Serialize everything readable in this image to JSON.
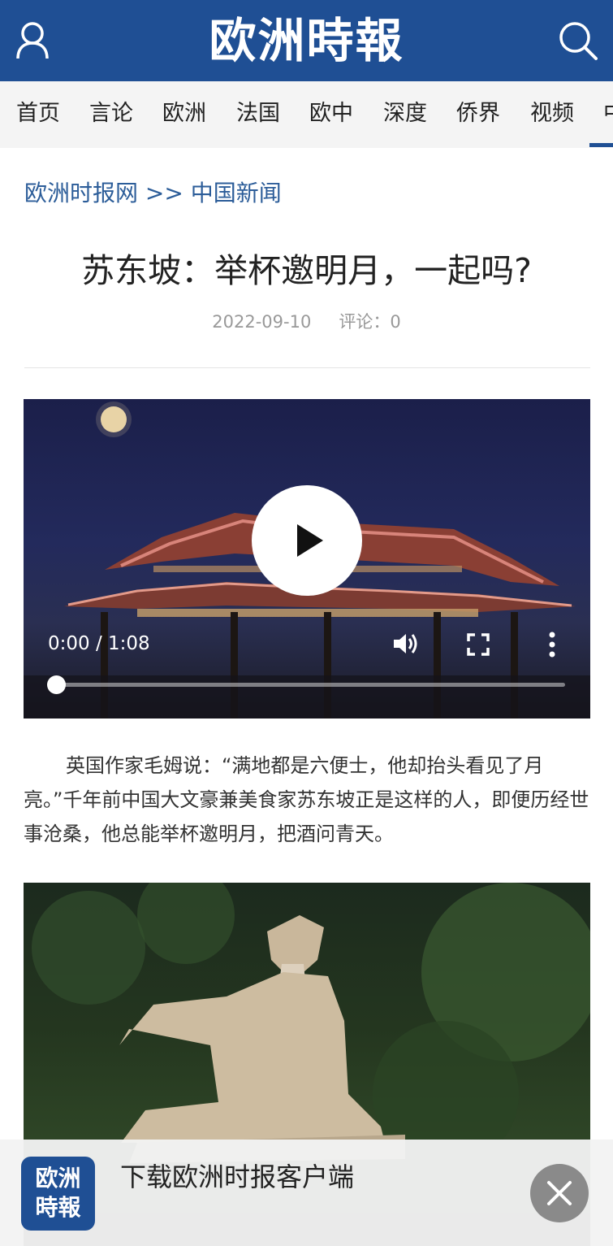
{
  "header": {
    "masthead": "欧洲時報",
    "user_icon": "user-icon",
    "search_icon": "search-icon",
    "brand_color": "#1f4f94"
  },
  "nav": {
    "items": [
      {
        "label": "首页"
      },
      {
        "label": "言论"
      },
      {
        "label": "欧洲"
      },
      {
        "label": "法国"
      },
      {
        "label": "欧中"
      },
      {
        "label": "深度"
      },
      {
        "label": "侨界"
      },
      {
        "label": "视频"
      },
      {
        "label": "中"
      }
    ]
  },
  "breadcrumb": {
    "site": "欧洲时报网",
    "separator": ">>",
    "section": "中国新闻"
  },
  "article": {
    "title": "苏东坡：举杯邀明月，一起吗?",
    "date": "2022-09-10",
    "comments": "评论：0",
    "paragraph": "英国作家毛姆说：“满地都是六便士，他却抬头看见了月亮。”千年前中国大文豪兼美食家苏东坡正是这样的人，即便历经世事沧桑，他总能举杯邀明月，把酒问青天。"
  },
  "video": {
    "time": "0:00 / 1:08",
    "progress": 0,
    "play_icon": "play-icon",
    "volume_icon": "volume-icon",
    "fullscreen_icon": "fullscreen-icon",
    "more_icon": "more-vertical-icon"
  },
  "banner": {
    "logo_text_line1": "欧洲",
    "logo_text_line2": "時報",
    "text": "下载欧洲时报客户端",
    "close_icon": "close-icon"
  }
}
